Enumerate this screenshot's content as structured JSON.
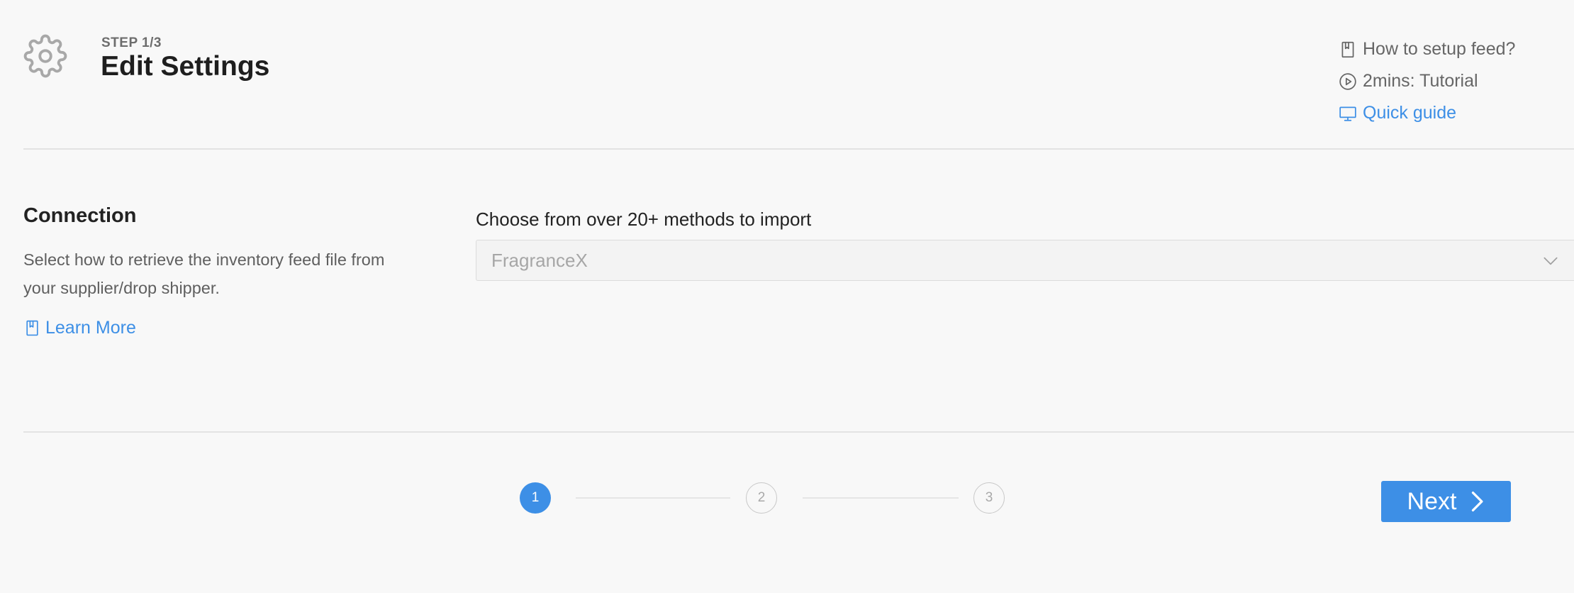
{
  "header": {
    "step_label": "STEP 1/3",
    "title": "Edit Settings",
    "icon": "gear-icon"
  },
  "help_links": [
    {
      "label": "How to setup feed?",
      "icon": "book-icon"
    },
    {
      "label": "2mins: Tutorial",
      "icon": "play-circle-icon"
    },
    {
      "label": "Quick guide",
      "icon": "monitor-icon"
    }
  ],
  "connection": {
    "title": "Connection",
    "description": "Select how to retrieve the inventory feed file from your supplier/drop shipper.",
    "learn_more": "Learn More"
  },
  "import_method": {
    "label": "Choose from over 20+ methods to import",
    "selected": "FragranceX"
  },
  "stepper": {
    "steps": [
      "1",
      "2",
      "3"
    ],
    "current": 1
  },
  "footer": {
    "next_label": "Next"
  },
  "colors": {
    "accent": "#3d8fe6",
    "background": "#f8f8f8",
    "muted_text": "#666666"
  }
}
